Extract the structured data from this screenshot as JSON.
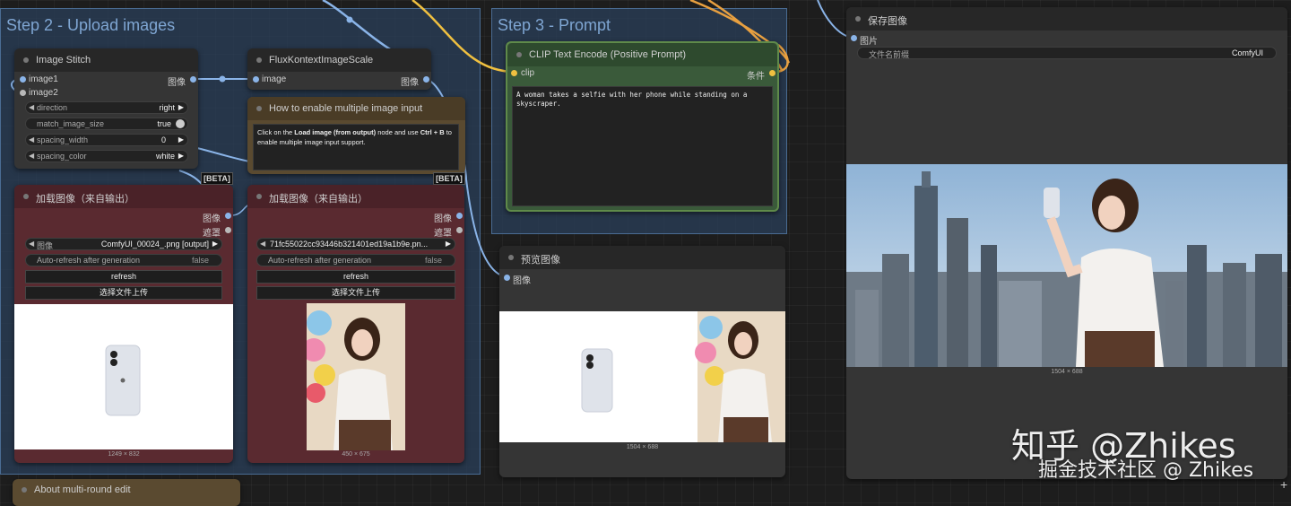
{
  "groups": {
    "step2_title": "Step 2 - Upload images",
    "step3_title": "Step 3 - Prompt"
  },
  "image_stitch": {
    "title": "Image Stitch",
    "inputs": [
      "image1",
      "image2"
    ],
    "output": "图像",
    "widgets": [
      {
        "label": "direction",
        "value": "right"
      },
      {
        "label": "match_image_size",
        "value": "true"
      },
      {
        "label": "spacing_width",
        "value": "0"
      },
      {
        "label": "spacing_color",
        "value": "white"
      }
    ]
  },
  "flux_scale": {
    "title": "FluxKontextImageScale",
    "input": "image",
    "output": "图像"
  },
  "note": {
    "title": "How to enable multiple image input",
    "text_lead": "Click on the ",
    "text_bold1": "Load image (from output)",
    "text_mid": " node and use ",
    "text_bold2": "Ctrl + B",
    "text_tail": " to enable multiple image input support."
  },
  "beta_label": "[BETA]",
  "load_left": {
    "title": "加载图像（来自输出）",
    "out_image": "图像",
    "out_mask": "遮罩",
    "image_label": "图像",
    "image_value": "ComfyUI_00024_.png [output]",
    "auto_label": "Auto-refresh after generation",
    "auto_value": "false",
    "refresh": "refresh",
    "upload": "选择文件上传",
    "caption": "1249 × 832"
  },
  "load_right": {
    "title": "加载图像（来自输出）",
    "out_image": "图像",
    "out_mask": "遮罩",
    "image_value": "71fc55022cc93446b321401ed19a1b9e.pn...",
    "auto_label": "Auto-refresh after generation",
    "auto_value": "false",
    "refresh": "refresh",
    "upload": "选择文件上传",
    "caption": "450 × 675"
  },
  "clip": {
    "title": "CLIP Text Encode (Positive Prompt)",
    "input": "clip",
    "output": "条件",
    "prompt": "A woman takes a selfie with her phone while standing on a skyscraper."
  },
  "preview": {
    "title": "预览图像",
    "input": "图像",
    "caption": "1504 × 688"
  },
  "save": {
    "title": "保存图像",
    "input": "图片",
    "prefix_label": "文件名前缀",
    "prefix_value": "ComfyUI",
    "caption": "1504 × 688"
  },
  "about": {
    "title": "About multi-round edit"
  },
  "watermark": {
    "line1": "知乎 @Zhikes",
    "line2": "掘金技术社区 @ Zhikes"
  },
  "colors": {
    "group_bg": "#2a405c",
    "clip_node": "#3a5a3a",
    "load_node": "#5a2a30",
    "note_node": "#5a4a30",
    "link_blue": "#8ab4e8",
    "link_yellow": "#f0c040",
    "link_orange": "#e8a040"
  }
}
